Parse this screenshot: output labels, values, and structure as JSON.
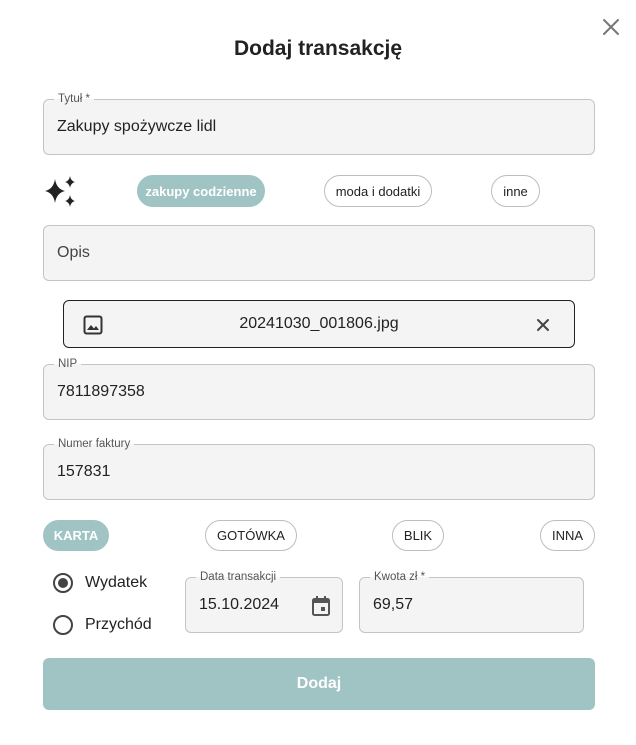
{
  "dialog": {
    "title": "Dodaj transakcję",
    "close_icon": "close-icon"
  },
  "title_field": {
    "label": "Tytuł *",
    "value": "Zakupy spożywcze lidl"
  },
  "ai_icon": "sparkles-icon",
  "categories": [
    {
      "label": "zakupy codzienne",
      "selected": true
    },
    {
      "label": "moda i dodatki",
      "selected": false
    },
    {
      "label": "inne",
      "selected": false
    }
  ],
  "description_field": {
    "placeholder": "Opis",
    "value": ""
  },
  "attachment": {
    "icon": "image-icon",
    "filename": "20241030_001806.jpg",
    "remove_icon": "close-icon"
  },
  "nip_field": {
    "label": "NIP",
    "value": "7811897358"
  },
  "invoice_field": {
    "label": "Numer faktury",
    "value": "157831"
  },
  "payment_methods": [
    {
      "label": "KARTA",
      "selected": true
    },
    {
      "label": "GOTÓWKA",
      "selected": false
    },
    {
      "label": "BLIK",
      "selected": false
    },
    {
      "label": "INNA",
      "selected": false
    }
  ],
  "transaction_type": [
    {
      "label": "Wydatek",
      "checked": true
    },
    {
      "label": "Przychód",
      "checked": false
    }
  ],
  "date_field": {
    "label": "Data transakcji",
    "value": "15.10.2024",
    "icon": "calendar-icon"
  },
  "amount_field": {
    "label": "Kwota zł *",
    "value": "69,57"
  },
  "submit_label": "Dodaj",
  "colors": {
    "accent": "#a0c4c4",
    "field_bg": "#f4f4f4",
    "border": "#c4c4c4"
  }
}
